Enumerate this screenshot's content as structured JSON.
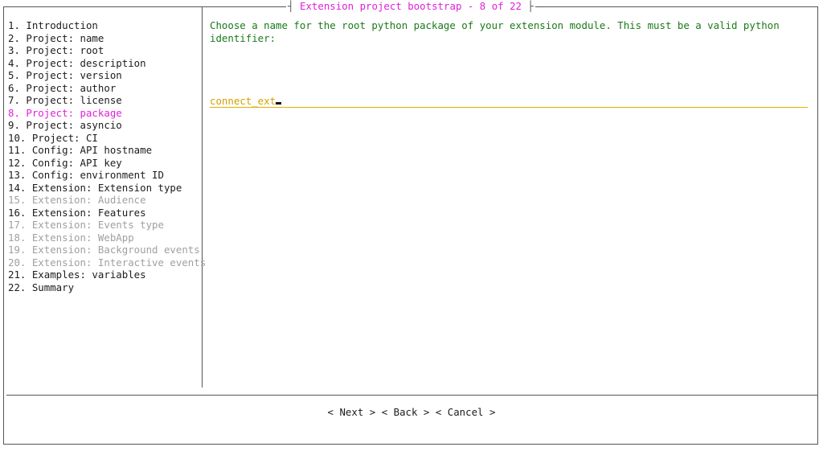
{
  "header": {
    "title": "Extension project bootstrap - 8 of 22"
  },
  "steps": [
    {
      "label": "1. Introduction",
      "state": "normal"
    },
    {
      "label": "2. Project: name",
      "state": "normal"
    },
    {
      "label": "3. Project: root",
      "state": "normal"
    },
    {
      "label": "4. Project: description",
      "state": "normal"
    },
    {
      "label": "5. Project: version",
      "state": "normal"
    },
    {
      "label": "6. Project: author",
      "state": "normal"
    },
    {
      "label": "7. Project: license",
      "state": "normal"
    },
    {
      "label": "8. Project: package",
      "state": "current"
    },
    {
      "label": "9. Project: asyncio",
      "state": "normal"
    },
    {
      "label": "10. Project: CI",
      "state": "normal"
    },
    {
      "label": "11. Config: API hostname",
      "state": "normal"
    },
    {
      "label": "12. Config: API key",
      "state": "normal"
    },
    {
      "label": "13. Config: environment ID",
      "state": "normal"
    },
    {
      "label": "14. Extension: Extension type",
      "state": "normal"
    },
    {
      "label": "15. Extension: Audience",
      "state": "disabled"
    },
    {
      "label": "16. Extension: Features",
      "state": "normal"
    },
    {
      "label": "17. Extension: Events type",
      "state": "disabled"
    },
    {
      "label": "18. Extension: WebApp",
      "state": "disabled"
    },
    {
      "label": "19. Extension: Background events",
      "state": "disabled"
    },
    {
      "label": "20. Extension: Interactive events",
      "state": "disabled"
    },
    {
      "label": "21. Examples: variables",
      "state": "normal"
    },
    {
      "label": "22. Summary",
      "state": "normal"
    }
  ],
  "content": {
    "question": "Choose a name for the root python package of your extension module. This must be a valid python identifier:",
    "input_value": "connect_ext"
  },
  "buttons": {
    "next": "< Next >",
    "back": "< Back >",
    "cancel": "< Cancel >"
  },
  "colors": {
    "accent": "#e020d8",
    "question": "#1a7a1a",
    "input": "#d4a000",
    "disabled": "#a0a0a0"
  }
}
